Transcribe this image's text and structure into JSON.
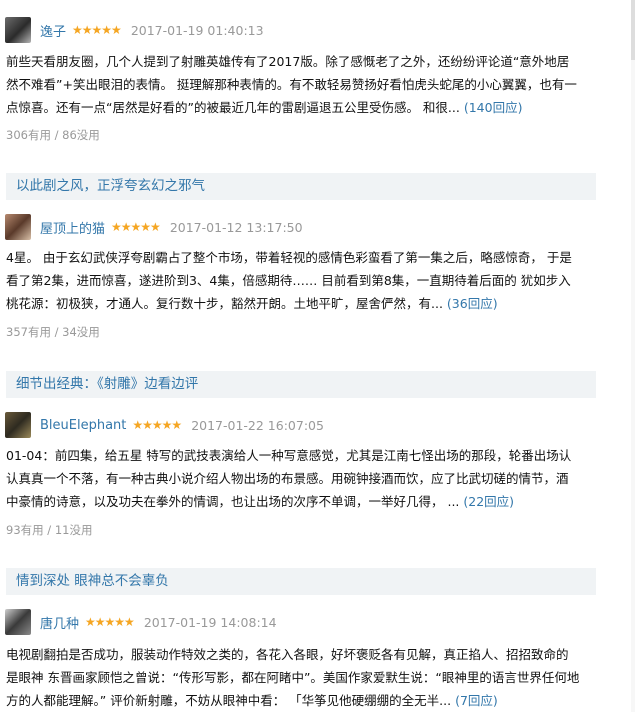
{
  "reviews": [
    {
      "author": "逸子",
      "stars": "★★★★★",
      "date": "2017-01-19 01:40:13",
      "lines": [
        "前些天看朋友圈，几个人提到了射雕英雄传有了2017版。除了感慨老了之外，还纷纷评论道“意外地居",
        "然不难看”+笑出眼泪的表情。 挺理解那种表情的。有不敢轻易赞扬好看怕虎头蛇尾的小心翼翼，也有一",
        "点惊喜。还有一点“居然是好看的”的被最近几年的雷剧逼退五公里受伤感。 和很..."
      ],
      "more": "(140回应)",
      "votes": "306有用 / 86没用"
    },
    {
      "author": "屋顶上的猫",
      "stars": "★★★★★",
      "date": "2017-01-12 13:17:50",
      "lines": [
        "4星。 由于玄幻武侠浮夸剧霸占了整个市场，带着轻视的感情色彩蛮看了第一集之后，略感惊奇， 于是",
        "看了第2集，进而惊喜，遂进阶到3、4集，倍感期待…… 目前看到第8集，一直期待着后面的 犹如步入",
        "桃花源：初极狭，才通人。复行数十步，豁然开朗。土地平旷，屋舍俨然，有..."
      ],
      "more": "(36回应)",
      "votes": "357有用 / 34没用"
    },
    {
      "author": "BleuElephant",
      "stars": "★★★★★",
      "date": "2017-01-22 16:07:05",
      "lines": [
        "01-04：前四集，给五星 特写的武技表演给人一种写意感觉，尤其是江南七怪出场的那段，轮番出场认",
        "认真真一个不落，有一种古典小说介绍人物出场的布景感。用碗钟接酒而饮，应了比武切磋的情节，酒",
        "中豪情的诗意，以及功夫在拳外的情调，也让出场的次序不单调，一举好几得， ..."
      ],
      "more": "(22回应)",
      "votes": "93有用 / 11没用"
    },
    {
      "author": "唐几种",
      "stars": "★★★★★",
      "date": "2017-01-19 14:08:14",
      "lines": [
        "电视剧翻拍是否成功，服装动作特效之类的，各花入各眼，好坏褒贬各有见解，真正掐人、招招致命的",
        "是眼神 东晋画家顾恺之曾说：“传形写影，都在阿睹中”。美国作家爱默生说：“眼神里的语言世界任何地",
        "方的人都能理解。” 评价新射雕，不妨从眼神中看： 「华筝见他硬绷绷的全无半..."
      ],
      "more": "(7回应)",
      "votes": ""
    }
  ],
  "sections": [
    "以此剧之风，正浮夸玄幻之邪气",
    "细节出经典：《射雕》边看边评",
    "情到深处 眼神总不会辜负"
  ],
  "colors": {
    "link": "#3377aa",
    "star": "#f5a623",
    "muted": "#999999",
    "section_bg": "#f0f3f5"
  }
}
